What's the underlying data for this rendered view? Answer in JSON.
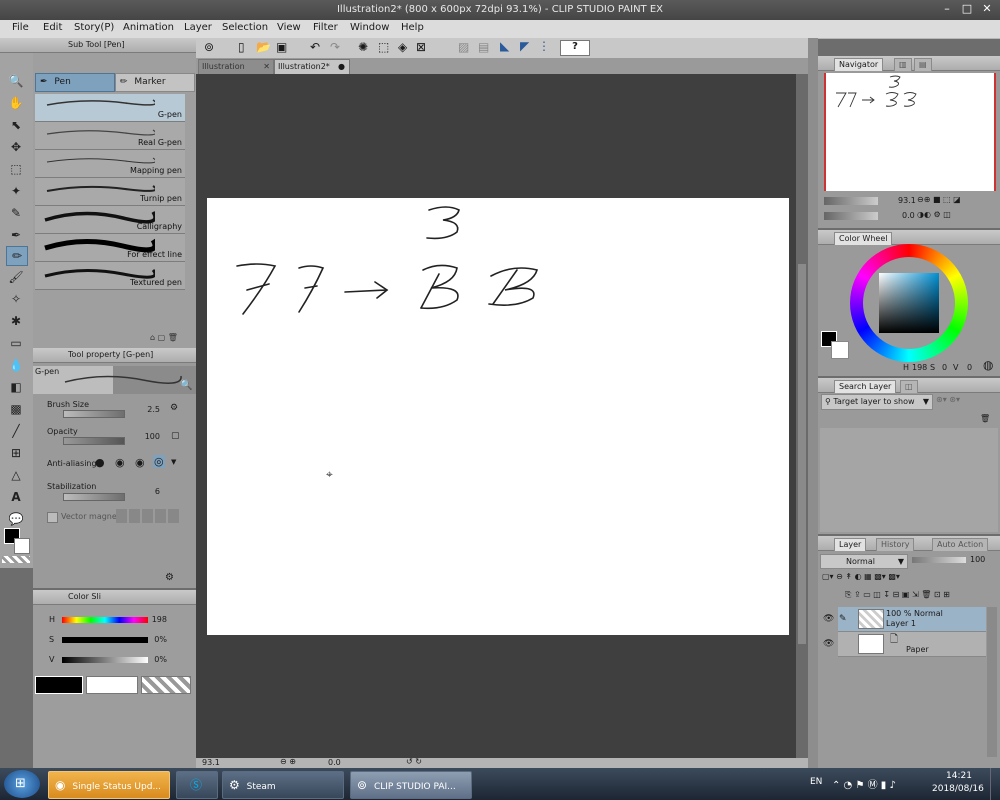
{
  "window": {
    "title": "Illustration2* (800 x 600px 72dpi 93.1%) - CLIP STUDIO PAINT EX"
  },
  "menu": [
    "File",
    "Edit",
    "Story(P)",
    "Animation",
    "Layer",
    "Selection",
    "View",
    "Filter",
    "Window",
    "Help"
  ],
  "doc_tabs": [
    {
      "label": "Illustration"
    },
    {
      "label": "Illustration2*"
    }
  ],
  "subtool": {
    "title": "Sub Tool [Pen]",
    "tabs": [
      "Pen",
      "Marker"
    ],
    "brushes": [
      "G-pen",
      "Real G-pen",
      "Mapping pen",
      "Turnip pen",
      "Calligraphy",
      "For effect line",
      "Textured pen"
    ]
  },
  "tool_property": {
    "title": "Tool property [G-pen]",
    "brush_name": "G-pen",
    "brush_size_label": "Brush Size",
    "brush_size_value": "2.5",
    "opacity_label": "Opacity",
    "opacity_value": "100",
    "anti_aliasing_label": "Anti-aliasing",
    "stabilization_label": "Stabilization",
    "stabilization_value": "6",
    "vector_magnet_label": "Vector magnet"
  },
  "color_slider": {
    "title": "Color Sli",
    "h_label": "H",
    "h_value": "198",
    "s_label": "S",
    "s_value": "0%",
    "v_label": "V",
    "v_value": "0%"
  },
  "navigator": {
    "title": "Navigator",
    "zoom": "93.1",
    "rotate": "0.0"
  },
  "color_wheel": {
    "title": "Color Wheel",
    "h": "198",
    "s": "0",
    "v": "0",
    "h_lbl": "H",
    "s_lbl": "S",
    "v_lbl": "V"
  },
  "search_layer": {
    "title": "Search Layer",
    "target_label": "Target layer to show"
  },
  "layer_panel": {
    "tabs": [
      "Layer",
      "History",
      "Auto Action"
    ],
    "blend_mode": "Normal",
    "opacity": "100",
    "layers": [
      {
        "line1": "100 % Normal",
        "line2": "Layer 1"
      },
      {
        "line1": "",
        "line2": "Paper"
      }
    ]
  },
  "status": {
    "zoom": "93.1",
    "rotate": "0.0"
  },
  "taskbar": {
    "items": [
      "Single Status Upd...",
      "Steam",
      "CLIP STUDIO PAI..."
    ],
    "lang": "EN",
    "time": "14:21",
    "date": "2018/08/16"
  },
  "colors": {
    "accent": "#7ea1bd",
    "canvas_bg": "#3f3f3f",
    "main_color": "#000000",
    "sub_color": "#ffffff"
  }
}
